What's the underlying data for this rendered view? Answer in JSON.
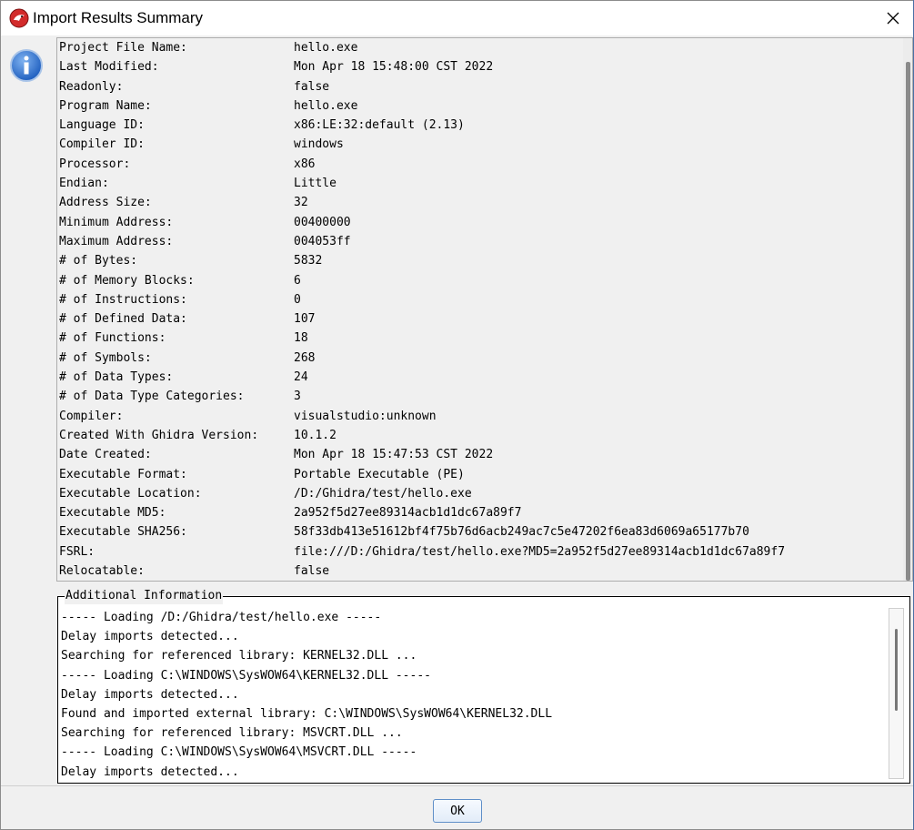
{
  "window": {
    "title": "Import Results Summary",
    "accent": "#5f8fc8"
  },
  "summary": {
    "rows": [
      {
        "key": "Project File Name:",
        "value": "hello.exe"
      },
      {
        "key": "Last Modified:",
        "value": "Mon Apr 18 15:48:00 CST 2022"
      },
      {
        "key": "Readonly:",
        "value": "false"
      },
      {
        "key": "Program Name:",
        "value": "hello.exe"
      },
      {
        "key": "Language ID:",
        "value": "x86:LE:32:default (2.13)"
      },
      {
        "key": "Compiler ID:",
        "value": "windows"
      },
      {
        "key": "Processor:",
        "value": "x86"
      },
      {
        "key": "Endian:",
        "value": "Little"
      },
      {
        "key": "Address Size:",
        "value": "32"
      },
      {
        "key": "Minimum Address:",
        "value": "00400000"
      },
      {
        "key": "Maximum Address:",
        "value": "004053ff"
      },
      {
        "key": "# of Bytes:",
        "value": "5832"
      },
      {
        "key": "# of Memory Blocks:",
        "value": "6"
      },
      {
        "key": "# of Instructions:",
        "value": "0"
      },
      {
        "key": "# of Defined Data:",
        "value": "107"
      },
      {
        "key": "# of Functions:",
        "value": "18"
      },
      {
        "key": "# of Symbols:",
        "value": "268"
      },
      {
        "key": "# of Data Types:",
        "value": "24"
      },
      {
        "key": "# of Data Type Categories:",
        "value": "3"
      },
      {
        "key": "Compiler:",
        "value": "visualstudio:unknown"
      },
      {
        "key": "Created With Ghidra Version:",
        "value": "10.1.2"
      },
      {
        "key": "Date Created:",
        "value": "Mon Apr 18 15:47:53 CST 2022"
      },
      {
        "key": "Executable Format:",
        "value": "Portable Executable (PE)"
      },
      {
        "key": "Executable Location:",
        "value": "/D:/Ghidra/test/hello.exe"
      },
      {
        "key": "Executable MD5:",
        "value": "2a952f5d27ee89314acb1d1dc67a89f7"
      },
      {
        "key": "Executable SHA256:",
        "value": "58f33db413e51612bf4f75b76d6acb249ac7c5e47202f6ea83d6069a65177b70"
      },
      {
        "key": "FSRL:",
        "value": "file:///D:/Ghidra/test/hello.exe?MD5=2a952f5d27ee89314acb1d1dc67a89f7"
      },
      {
        "key": "Relocatable:",
        "value": "false"
      }
    ]
  },
  "additional": {
    "legend": "Additional Information",
    "lines": [
      "----- Loading /D:/Ghidra/test/hello.exe -----",
      "Delay imports detected...",
      "Searching for referenced library: KERNEL32.DLL ...",
      "----- Loading C:\\WINDOWS\\SysWOW64\\KERNEL32.DLL -----",
      "Delay imports detected...",
      "Found and imported external library: C:\\WINDOWS\\SysWOW64\\KERNEL32.DLL",
      "Searching for referenced library: MSVCRT.DLL ...",
      "----- Loading C:\\WINDOWS\\SysWOW64\\MSVCRT.DLL -----",
      "Delay imports detected..."
    ]
  },
  "footer": {
    "ok_label": "OK"
  }
}
